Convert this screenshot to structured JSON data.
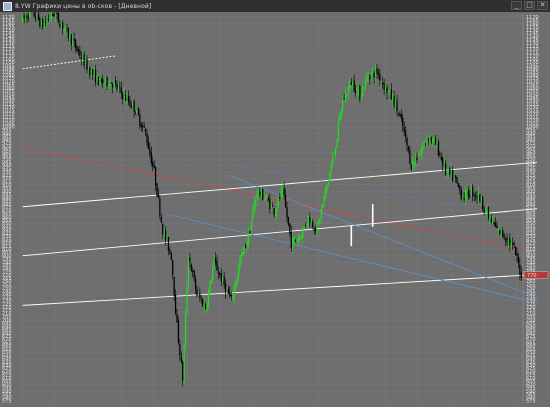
{
  "window": {
    "title": "8.YW Графики цены в ob-сков - [Дневной]",
    "buttons": [
      "_",
      "□",
      "✕"
    ]
  },
  "chart_data": {
    "type": "candlestick",
    "title": "",
    "xlabel": "",
    "ylabel": "",
    "ylim": [
      570,
      1175
    ],
    "grid": true,
    "y_ticks": [
      575,
      580,
      585,
      590,
      595,
      600,
      605,
      610,
      615,
      620,
      625,
      630,
      635,
      640,
      645,
      650,
      655,
      660,
      665,
      670,
      675,
      680,
      685,
      690,
      695,
      700,
      705,
      710,
      715,
      720,
      725,
      730,
      735,
      740,
      745,
      750,
      755,
      760,
      765,
      770,
      775,
      780,
      785,
      790,
      795,
      800,
      805,
      810,
      815,
      820,
      825,
      830,
      835,
      840,
      845,
      850,
      855,
      860,
      865,
      870,
      875,
      880,
      885,
      890,
      895,
      900,
      905,
      910,
      915,
      920,
      925,
      930,
      935,
      940,
      945,
      950,
      955,
      960,
      965,
      970,
      975,
      980,
      985,
      990,
      995,
      1000,
      1005,
      1010,
      1015,
      1020,
      1025,
      1030,
      1035,
      1040,
      1045,
      1050,
      1055,
      1060,
      1065,
      1070,
      1075,
      1080,
      1085,
      1090,
      1095,
      1100,
      1105,
      1110,
      1115,
      1120,
      1125,
      1130,
      1135,
      1140,
      1145,
      1150,
      1155,
      1160,
      1165,
      1170
    ],
    "y_tick_labels_left": [
      575,
      580,
      585,
      590,
      595,
      600,
      605,
      610,
      615,
      620,
      625,
      630,
      635,
      640,
      645,
      650,
      655,
      660,
      665,
      670,
      675,
      680,
      685,
      690,
      695,
      700,
      705,
      710,
      715,
      720,
      725,
      730,
      735,
      740,
      745,
      750,
      755,
      760,
      765,
      770,
      775,
      780,
      785,
      790,
      795,
      800,
      805,
      810,
      815,
      820,
      825,
      830,
      835,
      840,
      845,
      850,
      855,
      860,
      865,
      870,
      875,
      880,
      885,
      890,
      895,
      900,
      905,
      910,
      915,
      920,
      925,
      930,
      935,
      940,
      945,
      950,
      955,
      960,
      965,
      970,
      975,
      980,
      985,
      990,
      995,
      1000,
      1005,
      1010,
      1015,
      1020,
      1025,
      1030,
      1035,
      1040,
      1045,
      1050,
      1055,
      1060,
      1065,
      1070,
      1075,
      1080,
      1085,
      1090,
      1095,
      1100,
      1105,
      1110,
      1115,
      1120,
      1125,
      1130,
      1135,
      1140,
      1145,
      1150,
      1155,
      1160,
      1165,
      1170
    ],
    "current_price": "770",
    "anchors": [
      [
        0,
        1165
      ],
      [
        6,
        1180
      ],
      [
        14,
        1158
      ],
      [
        22,
        1176
      ],
      [
        30,
        1150
      ],
      [
        38,
        1120
      ],
      [
        46,
        1090
      ],
      [
        54,
        1068
      ],
      [
        62,
        1070
      ],
      [
        70,
        1050
      ],
      [
        78,
        1030
      ],
      [
        86,
        990
      ],
      [
        92,
        930
      ],
      [
        98,
        840
      ],
      [
        104,
        800
      ],
      [
        108,
        690
      ],
      [
        112,
        610
      ],
      [
        116,
        800
      ],
      [
        122,
        740
      ],
      [
        128,
        720
      ],
      [
        134,
        790
      ],
      [
        140,
        760
      ],
      [
        146,
        730
      ],
      [
        152,
        790
      ],
      [
        158,
        830
      ],
      [
        164,
        900
      ],
      [
        170,
        890
      ],
      [
        176,
        870
      ],
      [
        182,
        900
      ],
      [
        188,
        820
      ],
      [
        194,
        830
      ],
      [
        200,
        860
      ],
      [
        206,
        840
      ],
      [
        212,
        900
      ],
      [
        218,
        960
      ],
      [
        224,
        1040
      ],
      [
        230,
        1070
      ],
      [
        236,
        1050
      ],
      [
        242,
        1080
      ],
      [
        248,
        1085
      ],
      [
        254,
        1060
      ],
      [
        260,
        1040
      ],
      [
        266,
        1000
      ],
      [
        272,
        940
      ],
      [
        278,
        960
      ],
      [
        284,
        985
      ],
      [
        290,
        970
      ],
      [
        296,
        930
      ],
      [
        302,
        920
      ],
      [
        308,
        890
      ],
      [
        314,
        900
      ],
      [
        320,
        890
      ],
      [
        326,
        860
      ],
      [
        332,
        840
      ],
      [
        338,
        830
      ],
      [
        344,
        810
      ],
      [
        349,
        770
      ]
    ],
    "lines": [
      {
        "name": "red-trend",
        "color": "#c24a4a",
        "from": [
          0,
          968
        ],
        "to": [
          360,
          805
        ]
      },
      {
        "name": "upper-channel",
        "color": "#ffffff",
        "from": [
          0,
          876
        ],
        "to": [
          360,
          945
        ]
      },
      {
        "name": "middle-channel",
        "color": "#ffffff",
        "from": [
          0,
          800
        ],
        "to": [
          360,
          873
        ]
      },
      {
        "name": "lower-channel",
        "color": "#ffffff",
        "from": [
          0,
          723
        ],
        "to": [
          360,
          771
        ]
      },
      {
        "name": "blue-upper",
        "color": "#5d8fd0",
        "from": [
          144,
          925
        ],
        "to": [
          360,
          735
        ]
      },
      {
        "name": "blue-lower",
        "color": "#5d8fd0",
        "from": [
          100,
          865
        ],
        "to": [
          360,
          727
        ]
      },
      {
        "name": "blue-dotted",
        "color": "#4d7fc0",
        "from": [
          150,
          940
        ],
        "to": [
          310,
          876
        ]
      },
      {
        "name": "white-dotted",
        "color": "#ffffff",
        "from": [
          0,
          1090
        ],
        "to": [
          65,
          1110
        ]
      }
    ],
    "markers": [
      {
        "x": 230,
        "from": 847,
        "to": 815,
        "color": "#ffffff"
      },
      {
        "x": 245,
        "from": 880,
        "to": 845,
        "color": "#ffffff"
      }
    ]
  },
  "colors": {
    "background": "#6e6e6e",
    "grid": "#8a8a8a",
    "up": "#22dd22",
    "down": "#000000",
    "price_box": "#b23a3a"
  }
}
